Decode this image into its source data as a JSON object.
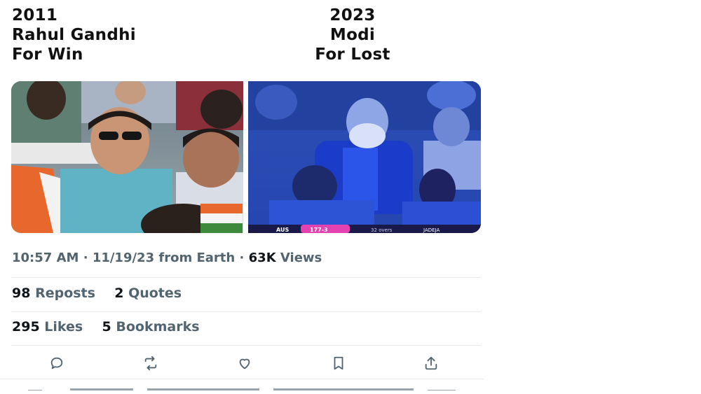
{
  "caption": {
    "left": {
      "year": "2011",
      "name": "Rahul Gandhi",
      "result": "For Win"
    },
    "right": {
      "year": "2023",
      "name": "Modi",
      "result": "For Lost"
    }
  },
  "media": {
    "right_scorebar": {
      "team": "AUS",
      "score": "177-3",
      "overs": "32 overs",
      "player": "JADEJA"
    }
  },
  "meta": {
    "time": "10:57 AM",
    "date": "11/19/23",
    "source": "from Earth",
    "views_count": "63K",
    "views_label": "Views",
    "separator": "·"
  },
  "stats": {
    "reposts_count": "98",
    "reposts_label": "Reposts",
    "quotes_count": "2",
    "quotes_label": "Quotes",
    "likes_count": "295",
    "likes_label": "Likes",
    "bookmarks_count": "5",
    "bookmarks_label": "Bookmarks"
  },
  "actions": [
    {
      "icon": "reply-icon"
    },
    {
      "icon": "repost-icon"
    },
    {
      "icon": "like-icon"
    },
    {
      "icon": "bookmark-icon"
    },
    {
      "icon": "share-icon"
    }
  ],
  "colors": {
    "text_primary": "#0f1419",
    "text_secondary": "#536471",
    "divider": "#e6ecf0",
    "action_icon": "#536471"
  }
}
